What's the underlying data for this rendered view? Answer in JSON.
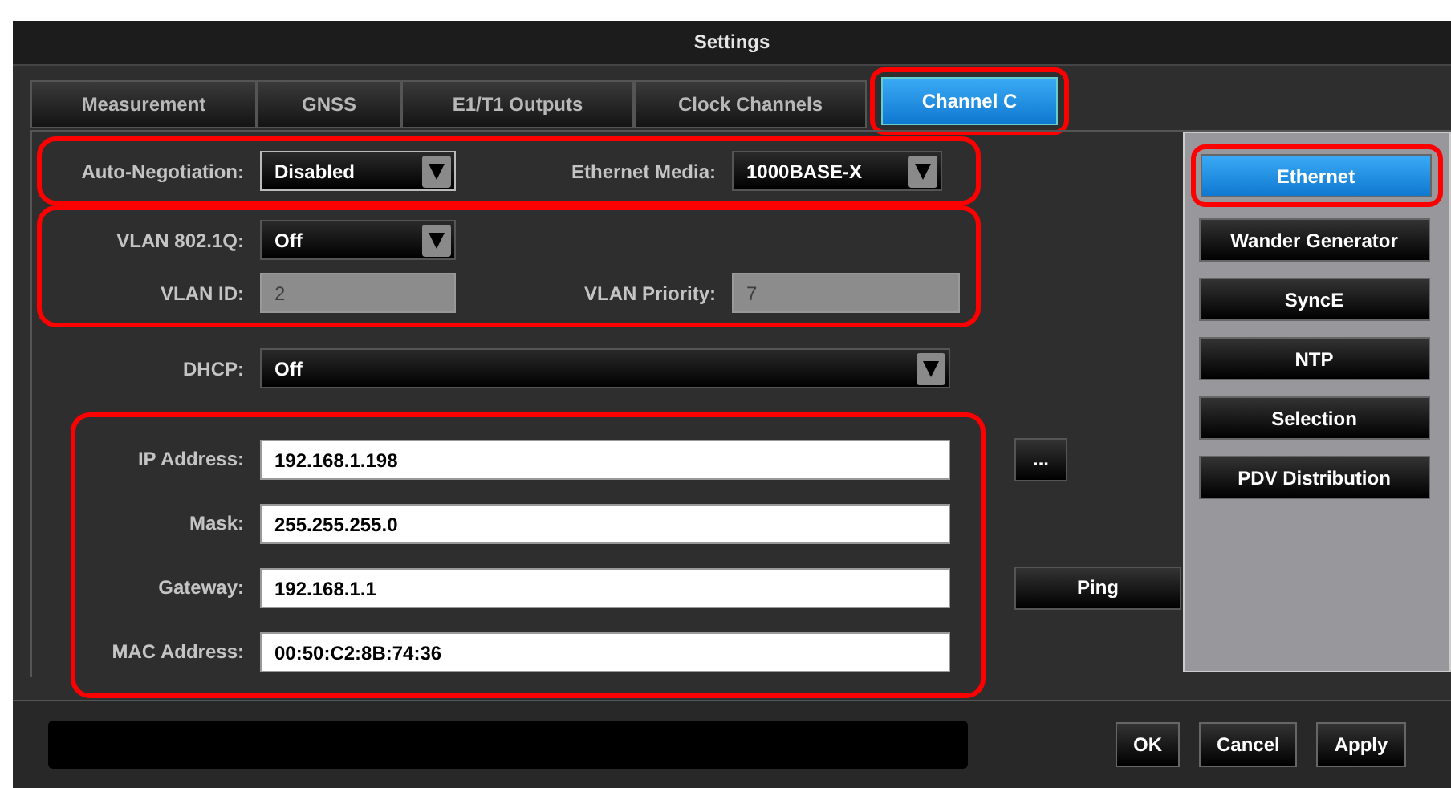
{
  "window": {
    "title": "Settings"
  },
  "tabs": [
    {
      "label": "Measurement",
      "selected": false,
      "highlighted": false
    },
    {
      "label": "GNSS",
      "selected": false,
      "highlighted": false
    },
    {
      "label": "E1/T1 Outputs",
      "selected": false,
      "highlighted": false
    },
    {
      "label": "Clock Channels",
      "selected": false,
      "highlighted": false
    },
    {
      "label": "Channel C",
      "selected": true,
      "highlighted": true
    }
  ],
  "groups": [
    {
      "highlighted": true,
      "rows": [
        {
          "fields": [
            {
              "label": "Auto-Negotiation:",
              "kind": "select",
              "value": "Disabled",
              "focused": true
            },
            {
              "label": "Ethernet Media:",
              "kind": "select",
              "value": "1000BASE-X",
              "focused": false
            }
          ]
        }
      ]
    },
    {
      "highlighted": true,
      "rows": [
        {
          "fields": [
            {
              "label": "VLAN 802.1Q:",
              "kind": "select",
              "value": "Off",
              "focused": false
            }
          ]
        },
        {
          "fields": [
            {
              "label": "VLAN ID:",
              "kind": "input",
              "value": "2",
              "disabled": true
            },
            {
              "label": "VLAN Priority:",
              "kind": "input",
              "value": "7",
              "disabled": true
            }
          ]
        }
      ]
    },
    {
      "rows": [
        {
          "fields": [
            {
              "label": "DHCP:",
              "kind": "wideselect",
              "value": "Off",
              "focused": false
            }
          ]
        }
      ]
    },
    {
      "highlighted": true,
      "rows": [
        {
          "fields": [
            {
              "label": "IP Address:",
              "kind": "wideinput",
              "value": "192.168.1.198",
              "disabled": false
            }
          ],
          "button": "..."
        },
        {
          "fields": [
            {
              "label": "Mask:",
              "kind": "wideinput",
              "value": "255.255.255.0",
              "disabled": false
            }
          ]
        },
        {
          "fields": [
            {
              "label": "Gateway:",
              "kind": "wideinput",
              "value": "192.168.1.1",
              "disabled": false
            }
          ],
          "button": "Ping"
        },
        {
          "fields": [
            {
              "label": "MAC Address:",
              "kind": "wideinput",
              "value": "00:50:C2:8B:74:36",
              "disabled": false
            }
          ]
        }
      ]
    }
  ],
  "sidebar": {
    "items": [
      {
        "label": "Ethernet",
        "selected": true,
        "highlighted": true
      },
      {
        "label": "Wander Generator",
        "selected": false,
        "highlighted": false
      },
      {
        "label": "SyncE",
        "selected": false,
        "highlighted": false
      },
      {
        "label": "NTP",
        "selected": false,
        "highlighted": false
      },
      {
        "label": "Selection",
        "selected": false,
        "highlighted": false
      },
      {
        "label": "PDV Distribution",
        "selected": false,
        "highlighted": false
      }
    ]
  },
  "buttons": [
    "OK",
    "Cancel",
    "Apply"
  ]
}
